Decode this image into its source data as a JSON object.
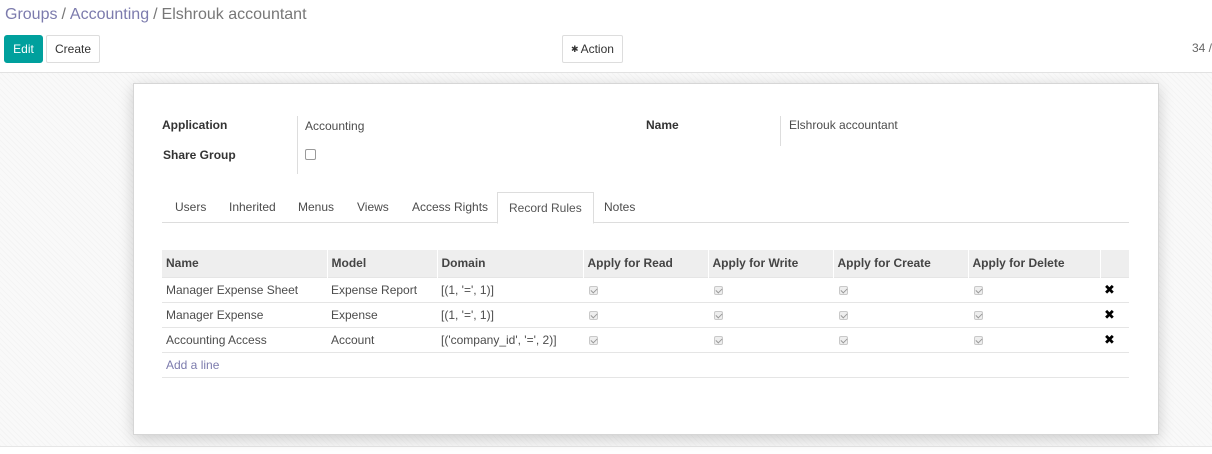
{
  "breadcrumb": {
    "items": [
      "Groups",
      "Accounting"
    ],
    "current": "Elshrouk accountant",
    "separator": "/"
  },
  "toolbar": {
    "edit_label": "Edit",
    "create_label": "Create",
    "action_label": "Action",
    "action_icon": "gear-icon"
  },
  "pager": {
    "text": "34 /"
  },
  "form": {
    "application_label": "Application",
    "application_value": "Accounting",
    "share_group_label": "Share Group",
    "share_group_checked": false,
    "name_label": "Name",
    "name_value": "Elshrouk accountant"
  },
  "tabs": [
    {
      "label": "Users"
    },
    {
      "label": "Inherited"
    },
    {
      "label": "Menus"
    },
    {
      "label": "Views"
    },
    {
      "label": "Access Rights"
    },
    {
      "label": "Record Rules"
    },
    {
      "label": "Notes"
    }
  ],
  "active_tab": "Record Rules",
  "table": {
    "columns": [
      "Name",
      "Model",
      "Domain",
      "Apply for Read",
      "Apply for Write",
      "Apply for Create",
      "Apply for Delete"
    ],
    "rows": [
      {
        "name": "Manager Expense Sheet",
        "model": "Expense Report",
        "domain": "[(1, '=', 1)]",
        "read": true,
        "write": true,
        "create": true,
        "delete": true
      },
      {
        "name": "Manager Expense",
        "model": "Expense",
        "domain": "[(1, '=', 1)]",
        "read": true,
        "write": true,
        "create": true,
        "delete": true
      },
      {
        "name": "Accounting Access",
        "model": "Account",
        "domain": "[('company_id', '=', 2)]",
        "read": true,
        "write": true,
        "create": true,
        "delete": true
      }
    ],
    "add_line_label": "Add a line",
    "delete_icon": "close-icon",
    "delete_glyph": "✖"
  },
  "colors": {
    "primary": "#00a09d",
    "link": "#7c7bad"
  }
}
